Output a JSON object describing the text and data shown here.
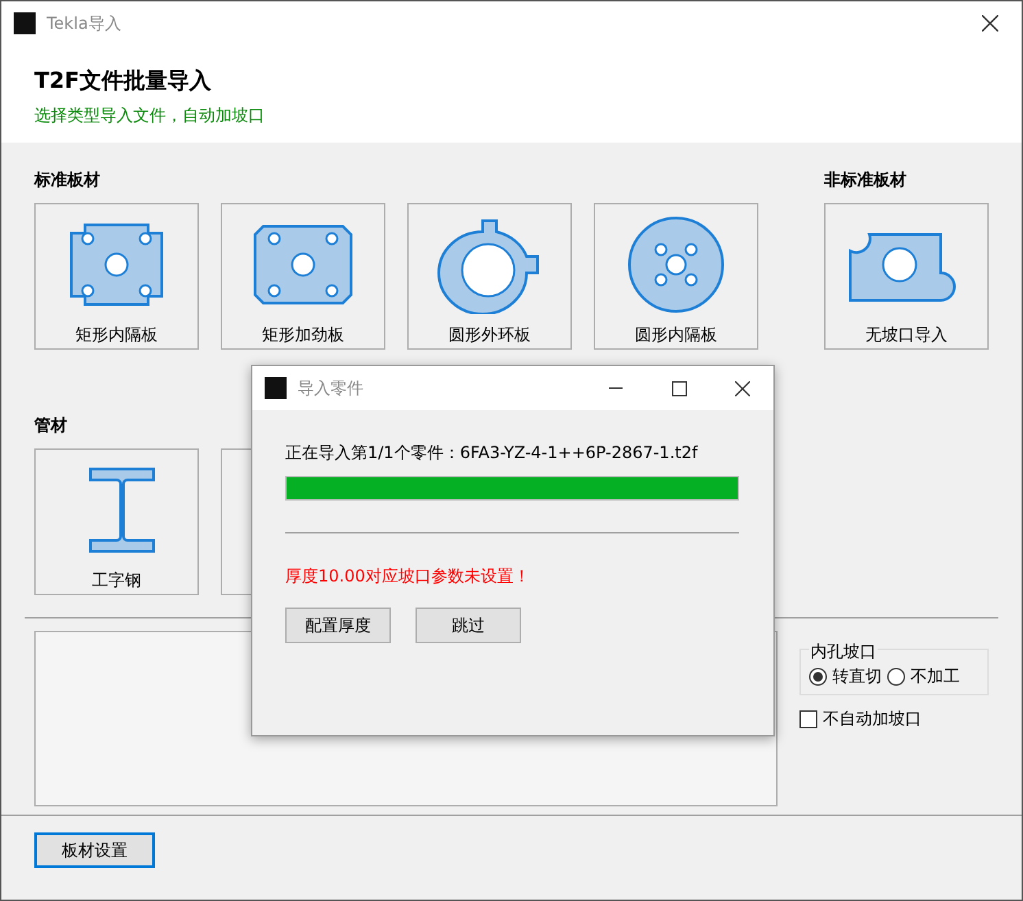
{
  "window": {
    "title": "Tekla导入"
  },
  "header": {
    "title": "T2F文件批量导入",
    "subtitle": "选择类型导入文件，自动加坡口"
  },
  "standard_plates": {
    "heading": "标准板材",
    "items": [
      {
        "label": "矩形内隔板",
        "kind": "rect-notched"
      },
      {
        "label": "矩形加劲板",
        "kind": "rect-chamfered"
      },
      {
        "label": "圆形外环板",
        "kind": "ring"
      },
      {
        "label": "圆形内隔板",
        "kind": "disc"
      }
    ]
  },
  "nonstandard_plates": {
    "heading": "非标准板材",
    "items": [
      {
        "label": "无坡口导入",
        "kind": "freeform"
      }
    ]
  },
  "tubes": {
    "heading": "管材",
    "items": [
      {
        "label": "工字钢",
        "kind": "i-beam"
      },
      {
        "kind": "covered"
      }
    ]
  },
  "hole_bevel": {
    "title": "内孔坡口",
    "options": [
      {
        "label": "转直切",
        "selected": true
      },
      {
        "label": "不加工",
        "selected": false
      }
    ]
  },
  "no_auto_bevel": {
    "label": "不自动加坡口",
    "checked": false
  },
  "footer_button": "板材设置",
  "dialog": {
    "title": "导入零件",
    "status": "正在导入第1/1个零件：6FA3-YZ-4-1++6P-2867-1.t2f",
    "progress": {
      "level": 1.0
    },
    "error": "厚度10.00对应坡口参数未设置！",
    "buttons": [
      "配置厚度",
      "跳过"
    ]
  }
}
